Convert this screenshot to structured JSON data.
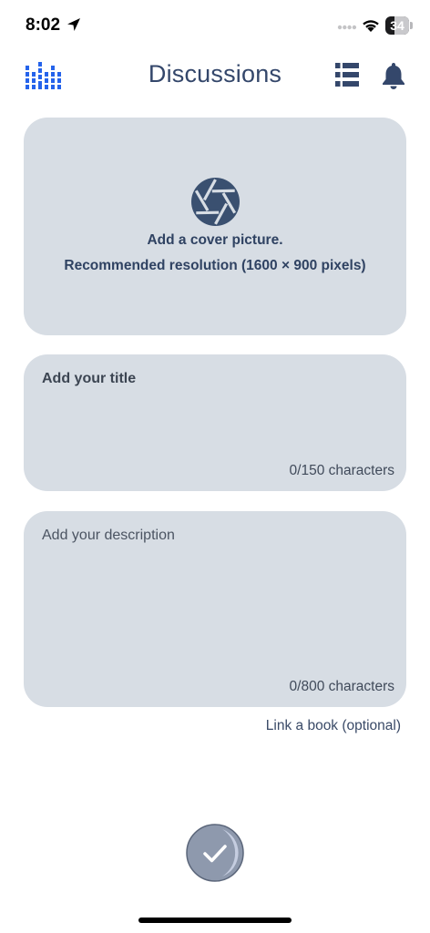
{
  "status_bar": {
    "time": "8:02",
    "battery": "34",
    "icons": [
      "location-arrow-icon",
      "signal-dots-icon",
      "wifi-icon",
      "battery-icon"
    ]
  },
  "header": {
    "title": "Discussions",
    "icons": [
      "logo-bars-icon",
      "list-icon",
      "bell-icon"
    ],
    "accent": "#2563eb",
    "title_color": "#34476b"
  },
  "cover": {
    "icon": "camera-aperture-icon",
    "line1": "Add a cover picture.",
    "line2": "Recommended resolution (1600 × 900 pixels)"
  },
  "title_field": {
    "placeholder": "Add your title",
    "counter": "0/150 characters"
  },
  "description_field": {
    "placeholder": "Add your description",
    "counter": "0/800 characters"
  },
  "link_book": "Link a book (optional)",
  "submit": {
    "icon": "checkmark-icon"
  },
  "colors": {
    "card_background": "#d7dde4",
    "text_dark_blue": "#2f4262",
    "button_grey": "#8e99ad"
  }
}
